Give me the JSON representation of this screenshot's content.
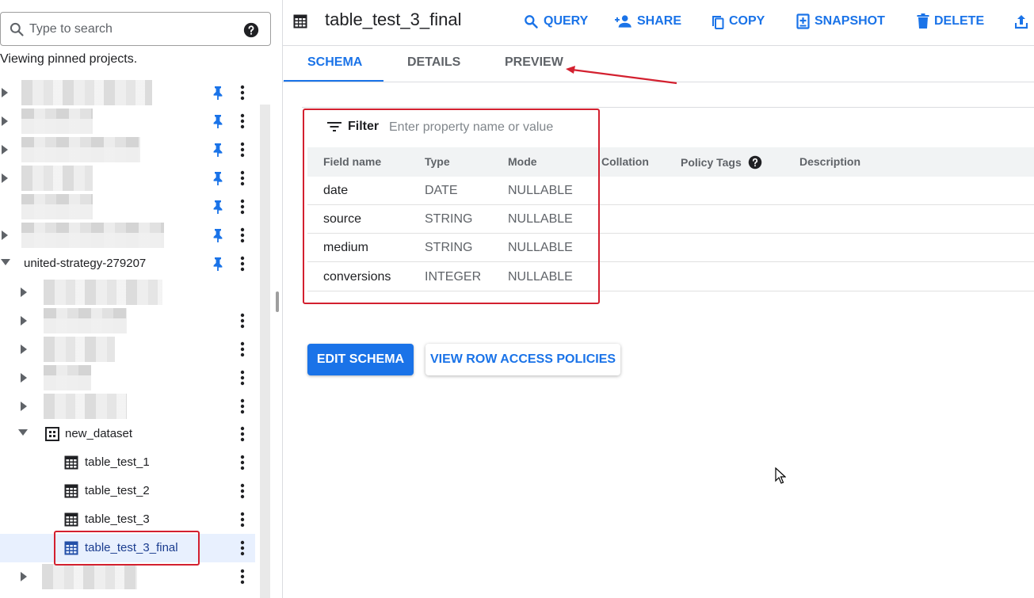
{
  "search": {
    "placeholder": "Type to search"
  },
  "explorer": {
    "pinned_note": "Viewing pinned projects.",
    "project": "united-strategy-279207",
    "dataset": "new_dataset",
    "tables": [
      "table_test_1",
      "table_test_2",
      "table_test_3",
      "table_test_3_final"
    ],
    "selected_table": "table_test_3_final"
  },
  "header": {
    "title": "table_test_3_final"
  },
  "toolbar": {
    "query": "QUERY",
    "share": "SHARE",
    "copy": "COPY",
    "snapshot": "SNAPSHOT",
    "delete": "DELETE"
  },
  "tabs": [
    {
      "label": "SCHEMA",
      "active": true
    },
    {
      "label": "DETAILS",
      "active": false
    },
    {
      "label": "PREVIEW",
      "active": false
    }
  ],
  "filter": {
    "label": "Filter",
    "placeholder": "Enter property name or value"
  },
  "schema": {
    "columns": [
      "Field name",
      "Type",
      "Mode",
      "Collation",
      "Policy Tags",
      "Description"
    ],
    "rows": [
      {
        "name": "date",
        "type": "DATE",
        "mode": "NULLABLE"
      },
      {
        "name": "source",
        "type": "STRING",
        "mode": "NULLABLE"
      },
      {
        "name": "medium",
        "type": "STRING",
        "mode": "NULLABLE"
      },
      {
        "name": "conversions",
        "type": "INTEGER",
        "mode": "NULLABLE"
      }
    ]
  },
  "actions": {
    "edit_schema": "EDIT SCHEMA",
    "view_row_access": "VIEW ROW ACCESS POLICIES"
  },
  "colors": {
    "accent": "#1a73e8",
    "annotation": "#d3202f",
    "selected_bg": "#e8f0fe"
  },
  "icons": [
    "search-icon",
    "help-icon",
    "pin-icon",
    "more-vert-icon",
    "dataset-icon",
    "table-icon",
    "query-icon",
    "share-icon",
    "copy-icon",
    "snapshot-icon",
    "delete-icon",
    "export-icon",
    "filter-icon"
  ]
}
